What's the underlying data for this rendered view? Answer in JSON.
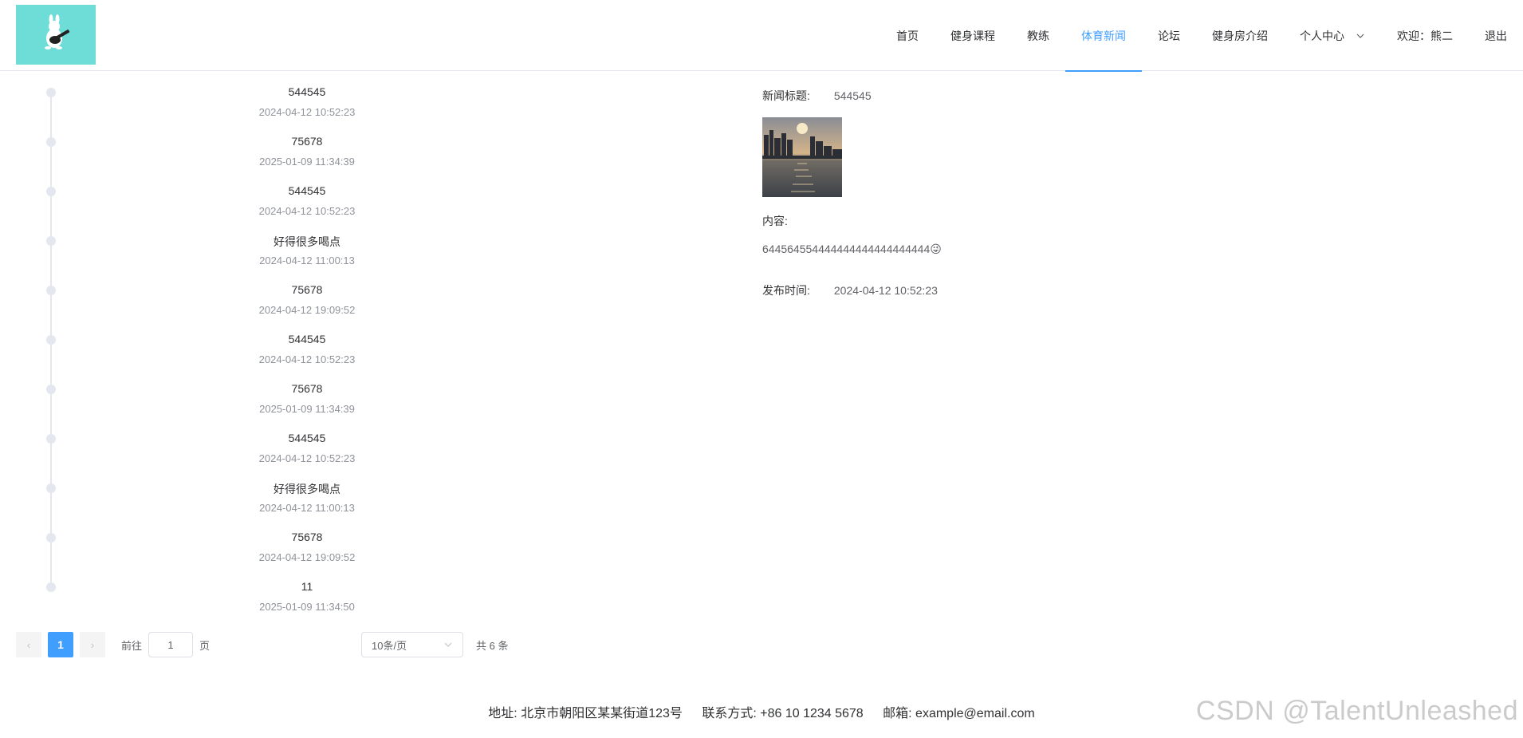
{
  "nav": {
    "items": [
      "首页",
      "健身课程",
      "教练",
      "体育新闻",
      "论坛",
      "健身房介绍"
    ],
    "active_index": 3,
    "personal_center": "个人中心",
    "welcome": "欢迎：熊二",
    "logout": "退出"
  },
  "timeline": [
    {
      "title": "544545",
      "date": "2024-04-12 10:52:23"
    },
    {
      "title": "75678",
      "date": "2025-01-09 11:34:39"
    },
    {
      "title": "544545",
      "date": "2024-04-12 10:52:23"
    },
    {
      "title": "好得很多喝点",
      "date": "2024-04-12 11:00:13"
    },
    {
      "title": "75678",
      "date": "2024-04-12 19:09:52"
    },
    {
      "title": "544545",
      "date": "2024-04-12 10:52:23"
    },
    {
      "title": "75678",
      "date": "2025-01-09 11:34:39"
    },
    {
      "title": "544545",
      "date": "2024-04-12 10:52:23"
    },
    {
      "title": "好得很多喝点",
      "date": "2024-04-12 11:00:13"
    },
    {
      "title": "75678",
      "date": "2024-04-12 19:09:52"
    },
    {
      "title": "11",
      "date": "2025-01-09 11:34:50"
    }
  ],
  "pagination": {
    "prev": "‹",
    "current_page": "1",
    "next": "›",
    "goto_prefix": "前往",
    "goto_value": "1",
    "goto_suffix": "页",
    "page_size": "10条/页",
    "total": "共 6 条"
  },
  "detail": {
    "title_label": "新闻标题:",
    "title_value": "544545",
    "content_label": "内容:",
    "content_value": "644564554444444444444444444😜",
    "time_label": "发布时间:",
    "time_value": "2024-04-12 10:52:23"
  },
  "footer": {
    "address": "地址: 北京市朝阳区某某街道123号",
    "contact": "联系方式: +86 10 1234 5678",
    "email": "邮箱: example@email.com"
  },
  "watermark": "CSDN @TalentUnleashed",
  "colors": {
    "accent": "#409eff",
    "logo_bg": "#6edcd7"
  }
}
